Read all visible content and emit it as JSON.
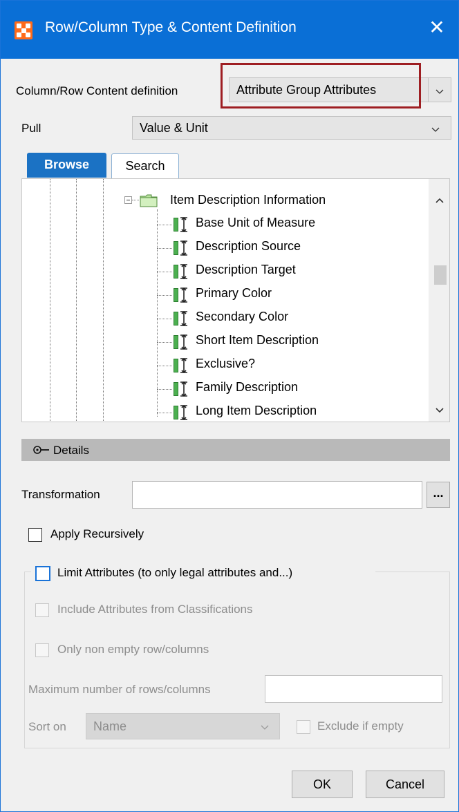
{
  "window": {
    "title": "Row/Column Type & Content Definition"
  },
  "content_definition": {
    "label": "Column/Row Content definition",
    "value": "Attribute Group Attributes"
  },
  "pull": {
    "label": "Pull",
    "value": "Value & Unit"
  },
  "tabs": [
    {
      "label": "Browse"
    },
    {
      "label": "Search"
    }
  ],
  "tree": {
    "group_node": "Item Description Information",
    "items": [
      "Base Unit of Measure",
      "Description Source",
      "Description Target",
      "Primary Color",
      "Secondary Color",
      "Short Item Description",
      "Exclusive?",
      "Family Description",
      "Long Item Description"
    ]
  },
  "details": {
    "label": "Details"
  },
  "transformation": {
    "label": "Transformation",
    "value": "",
    "browse_label": "..."
  },
  "apply_recursively": {
    "label": "Apply Recursively",
    "checked": false
  },
  "limit_attributes": {
    "label": "Limit Attributes (to only legal attributes and...)",
    "checked": false
  },
  "include_classifications": {
    "label": "Include Attributes from Classifications",
    "checked": false
  },
  "only_non_empty": {
    "label": "Only non empty row/columns",
    "checked": false
  },
  "max_rows": {
    "label": "Maximum number of rows/columns",
    "value": ""
  },
  "sort_on": {
    "label": "Sort on",
    "value": "Name"
  },
  "exclude_if_empty": {
    "label": "Exclude if empty",
    "checked": false
  },
  "buttons": {
    "ok": "OK",
    "cancel": "Cancel"
  },
  "colors": {
    "titlebar": "#0a6fd6",
    "highlight_box": "#9e1e22",
    "tab_active": "#1b72c4",
    "attr_icon_green": "#4caf50"
  }
}
